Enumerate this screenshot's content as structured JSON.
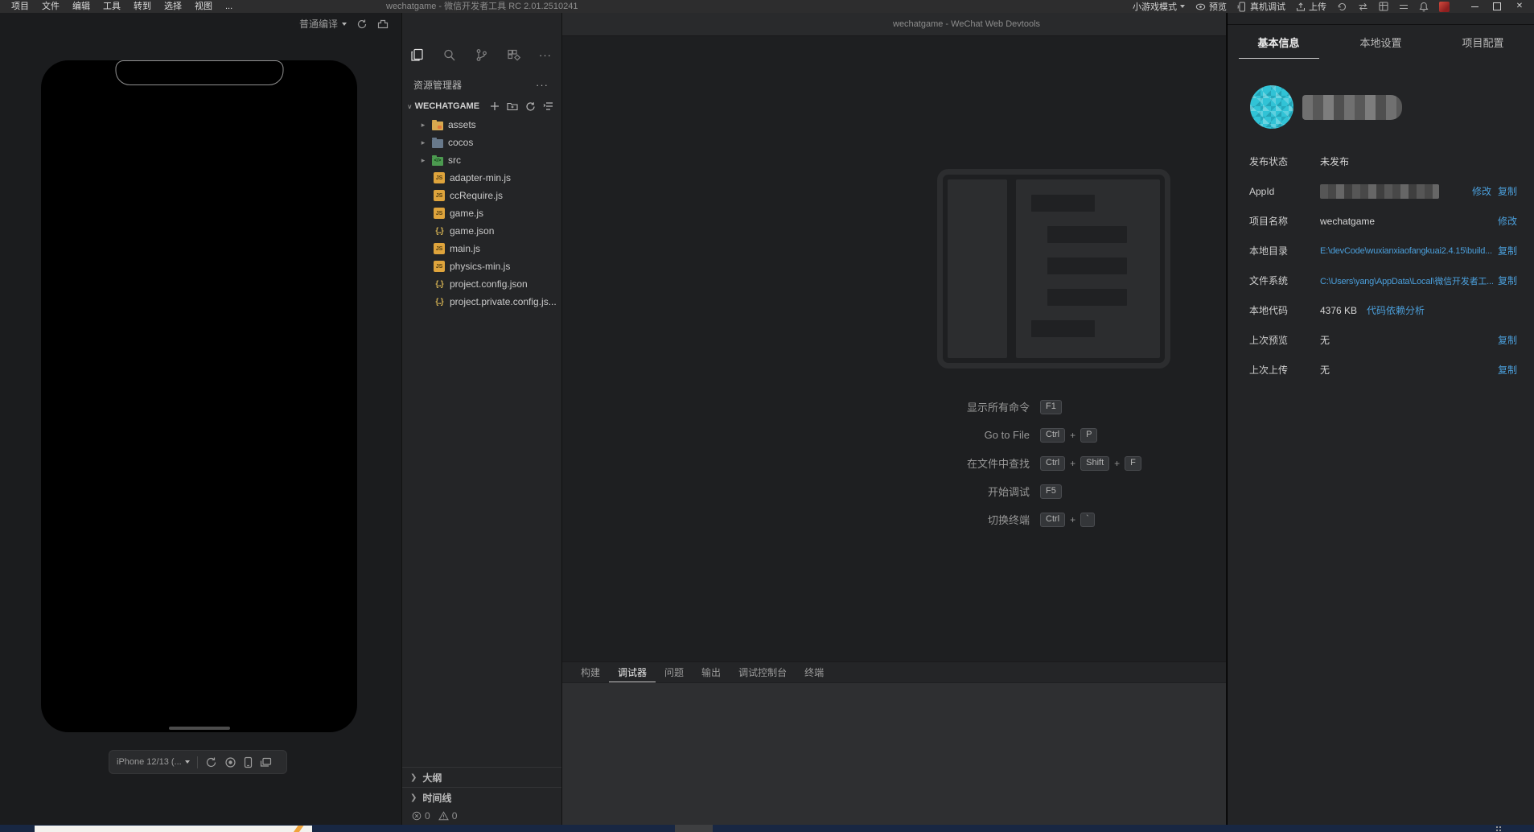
{
  "window": {
    "title": "wechatgame - 微信开发者工具 RC 2.01.2510241",
    "menus": [
      "项目",
      "文件",
      "编辑",
      "工具",
      "转到",
      "选择",
      "视图",
      "..."
    ],
    "toolbar": {
      "mode_label": "小游戏模式",
      "preview_label": "预览",
      "remote_debug_label": "真机调试",
      "upload_label": "上传"
    }
  },
  "simulator": {
    "compile_mode": "普通编译",
    "device": "iPhone 12/13 (..."
  },
  "explorer": {
    "title": "资源管理器",
    "project": "WECHATGAME",
    "files": [
      {
        "name": "assets",
        "type": "folder-assets",
        "expandable": true
      },
      {
        "name": "cocos",
        "type": "folder-cocos",
        "expandable": true
      },
      {
        "name": "src",
        "type": "folder-src",
        "expandable": true
      },
      {
        "name": "adapter-min.js",
        "type": "js"
      },
      {
        "name": "ccRequire.js",
        "type": "js"
      },
      {
        "name": "game.js",
        "type": "js"
      },
      {
        "name": "game.json",
        "type": "json"
      },
      {
        "name": "main.js",
        "type": "js"
      },
      {
        "name": "physics-min.js",
        "type": "js"
      },
      {
        "name": "project.config.json",
        "type": "json"
      },
      {
        "name": "project.private.config.js...",
        "type": "json"
      }
    ],
    "sections": [
      "大纲",
      "时间线"
    ],
    "problems": {
      "errors": "0",
      "warnings": "0"
    }
  },
  "editor": {
    "header_title": "wechatgame - WeChat Web Devtools",
    "keys_separator": "+",
    "shortcuts": [
      {
        "label": "显示所有命令",
        "keys": [
          "F1"
        ]
      },
      {
        "label": "Go to File",
        "keys": [
          "Ctrl",
          "P"
        ]
      },
      {
        "label": "在文件中查找",
        "keys": [
          "Ctrl",
          "Shift",
          "F"
        ]
      },
      {
        "label": "开始调试",
        "keys": [
          "F5"
        ]
      },
      {
        "label": "切换终端",
        "keys": [
          "Ctrl",
          "`"
        ]
      }
    ]
  },
  "panel": {
    "tabs": [
      {
        "label": "构建",
        "active": false
      },
      {
        "label": "调试器",
        "active": true
      },
      {
        "label": "问题",
        "active": false
      },
      {
        "label": "输出",
        "active": false
      },
      {
        "label": "调试控制台",
        "active": false
      },
      {
        "label": "终端",
        "active": false
      }
    ]
  },
  "details": {
    "tabs": [
      {
        "label": "基本信息",
        "active": true
      },
      {
        "label": "本地设置",
        "active": false
      },
      {
        "label": "项目配置",
        "active": false
      }
    ],
    "rows": [
      {
        "label": "发布状态",
        "value": "未发布",
        "links": []
      },
      {
        "label": "AppId",
        "value": "",
        "blurred": true,
        "links": [
          "修改",
          "复制"
        ]
      },
      {
        "label": "项目名称",
        "value": "wechatgame",
        "links": [
          "修改"
        ]
      },
      {
        "label": "本地目录",
        "value": "E:\\devCode\\wuxianxiaofangkuai2.4.15\\build...",
        "value_link": true,
        "links": [
          "复制"
        ]
      },
      {
        "label": "文件系统",
        "value": "C:\\Users\\yang\\AppData\\Local\\微信开发者工...",
        "value_link": true,
        "links": [
          "复制"
        ]
      },
      {
        "label": "本地代码",
        "value": "4376 KB",
        "extra_link": "代码依赖分析",
        "links": []
      },
      {
        "label": "上次预览",
        "value": "无",
        "links": [
          "复制"
        ]
      },
      {
        "label": "上次上传",
        "value": "无",
        "links": [
          "复制"
        ]
      }
    ]
  },
  "colors": {
    "accent_blue": "#4b9fdb",
    "avatar_teal": "#31c3d6",
    "js_icon_yellow": "#dfa43c",
    "folder_assets": "#d8a94f",
    "folder_cocos": "#68798b",
    "folder_src": "#4c9a50",
    "titlebar_bg": "#2d2d2e",
    "panel_bg": "#242527",
    "editor_bg": "#1e1f21"
  }
}
